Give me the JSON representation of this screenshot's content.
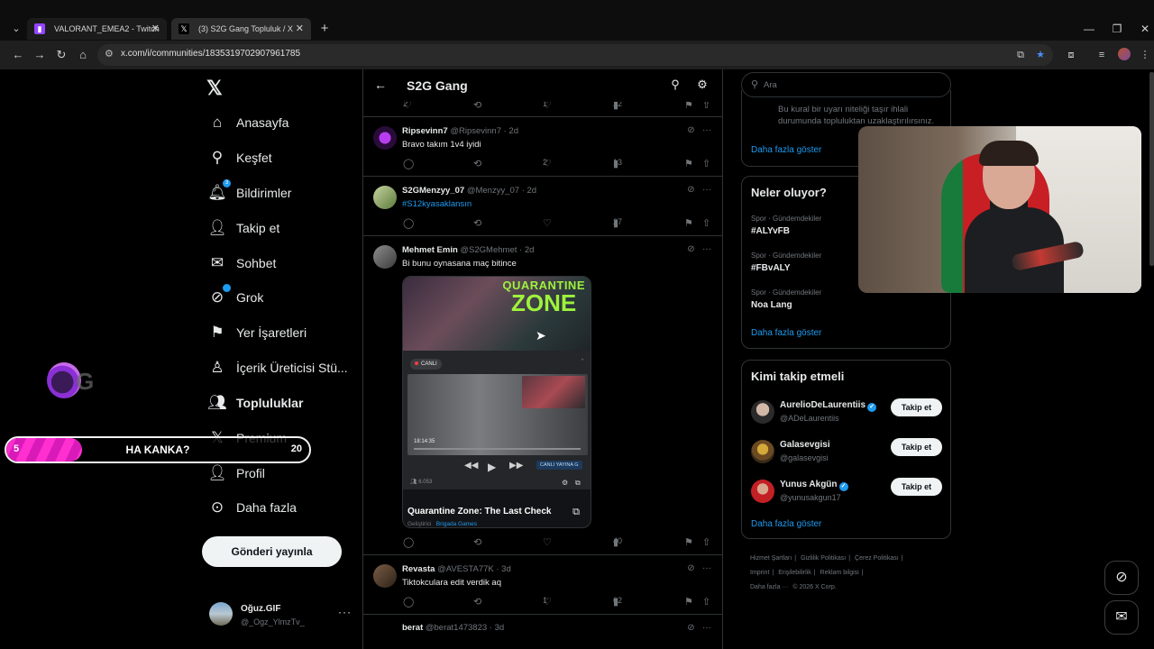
{
  "browser": {
    "tabs": [
      {
        "title": "VALORANT_EMEA2 - Twitch",
        "icon": "twitch-icon",
        "color": "#9146ff"
      },
      {
        "title": "(3) S2G Gang Topluluk / X",
        "icon": "x-logo-icon",
        "color": "#000000"
      }
    ],
    "url": "x.com/i/communities/1835319702907961785"
  },
  "nav": {
    "items": [
      {
        "label": "Anasayfa",
        "icon": "home-icon"
      },
      {
        "label": "Keşfet",
        "icon": "search-icon"
      },
      {
        "label": "Bildirimler",
        "icon": "bell-icon",
        "badge": "3"
      },
      {
        "label": "Takip et",
        "icon": "add-user-icon"
      },
      {
        "label": "Sohbet",
        "icon": "mail-icon"
      },
      {
        "label": "Grok",
        "icon": "grok-icon"
      },
      {
        "label": "Yer İşaretleri",
        "icon": "bookmark-icon"
      },
      {
        "label": "İçerik Üreticisi Stü...",
        "icon": "creator-studio-icon"
      },
      {
        "label": "Topluluklar",
        "icon": "communities-icon"
      },
      {
        "label": "Premium",
        "icon": "x-logo-icon"
      },
      {
        "label": "Profil",
        "icon": "profile-icon"
      },
      {
        "label": "Daha fazla",
        "icon": "more-circle-icon"
      }
    ],
    "post_button": "Gönderi yayınla",
    "account": {
      "name": "Oğuz.GIF",
      "handle": "@_Ogz_YlmzTv_"
    }
  },
  "stream_overlay": {
    "hype_start": "5",
    "hype_title": "HA KANKA?",
    "hype_end": "20",
    "hype_progress": 0.25,
    "hype_color": "#ff2fd0"
  },
  "feed": {
    "title": "S2G Gang",
    "top_actions": {
      "likes": "1",
      "views": "22"
    },
    "tweets": [
      {
        "name": "Ripsevinn7",
        "meta": "@Ripsevinn7 · 2d",
        "text": "Bravo takım 1v4 iyidi",
        "likes": "2",
        "views": "13"
      },
      {
        "name": "S2GMenzyy_07",
        "meta": "@Menzyy_07 · 2d",
        "text": "#S12kyasaklansın",
        "likes": "",
        "views": "27"
      },
      {
        "name": "Mehmet Emin",
        "meta": "@S2GMehmet · 2d",
        "text": "Bi bunu oynasana maç bitince",
        "likes": "",
        "views": "40",
        "card": {
          "banner_top": "QUARANTINE",
          "banner_main": "ZONE",
          "live_badge": "CANLI",
          "video_time": "18:14:35",
          "live_pill": "CANLI YAYINA G",
          "viewer_count": "6.053",
          "title": "Quarantine Zone: The Last Check",
          "sub_label": "Geliştirici",
          "publisher": "Brigada Games"
        }
      },
      {
        "name": "Revasta",
        "meta": "@AVESTA77K · 3d",
        "text": "Tiktokculara edit verdik aq",
        "likes": "1",
        "views": "62"
      },
      {
        "name": "berat",
        "meta": "@berat1473823 · 3d",
        "text": "",
        "likes": "",
        "views": ""
      }
    ]
  },
  "right": {
    "search_placeholder": "Ara",
    "rules_text": "Bu kural bir uyarı niteliği taşır ihlali durumunda topluluktan uzaklaştırılırsınız.",
    "show_more": "Daha fazla göster",
    "trends_title": "Neler oluyor?",
    "trends": [
      {
        "category": "Spor · Gündemdekiler",
        "name": "#ALYvFB"
      },
      {
        "category": "Spor · Gündemdekiler",
        "name": "#FBvALY"
      },
      {
        "category": "Spor · Gündemdekiler",
        "name": "Noa Lang"
      }
    ],
    "who_title": "Kimi takip etmeli",
    "who": [
      {
        "name": "AurelioDeLaurentiis",
        "handle": "@ADeLaurentiis",
        "verified": true
      },
      {
        "name": "Galasevgisi",
        "handle": "@galasevgisi",
        "verified": false
      },
      {
        "name": "Yunus Akgün",
        "handle": "@yunusakgun17",
        "verified": true
      }
    ],
    "follow_label": "Takip et",
    "footer": {
      "line1": [
        "Hizmet Şartları",
        "|",
        "Gizlilik Politikası",
        "|",
        "Çerez Politikası",
        "|"
      ],
      "line2": [
        "Imprint",
        "|",
        "Erişilebilirlik",
        "|",
        "Reklam bilgisi",
        "|"
      ],
      "line3": [
        "Daha fazla ···",
        "© 2026 X Corp."
      ]
    }
  }
}
